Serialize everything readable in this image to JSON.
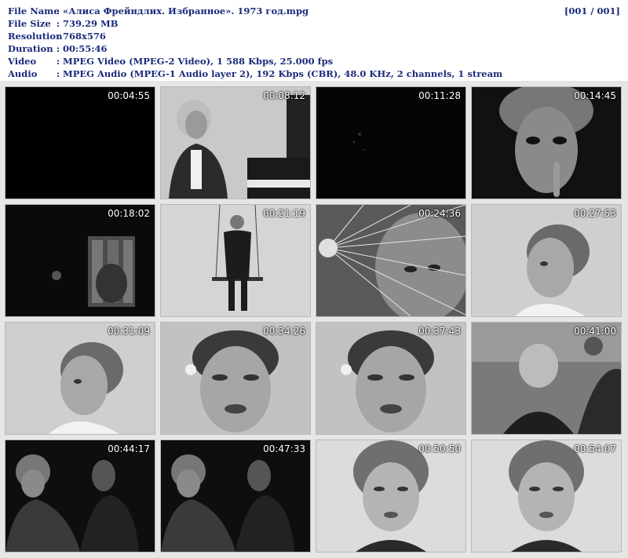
{
  "info": {
    "rows": [
      {
        "label": "File Name",
        "value": "«Алиса Фрейндлих. Избранное». 1973 год.mpg"
      },
      {
        "label": "File Size",
        "value": "739.29 MB"
      },
      {
        "label": "Resolution",
        "value": "768x576"
      },
      {
        "label": "Duration",
        "value": "00:55:46"
      },
      {
        "label": "Video",
        "value": "MPEG Video (MPEG-2 Video), 1 588 Kbps, 25.000 fps"
      },
      {
        "label": "Audio",
        "value": "MPEG Audio (MPEG-1 Audio layer 2), 192 Kbps (CBR), 48.0 KHz, 2 channels, 1 stream"
      }
    ],
    "separator": ":",
    "counter": "[001 / 001]"
  },
  "thumbnails": [
    {
      "time": "00:04:55",
      "scene": "black-frame"
    },
    {
      "time": "00:08:12",
      "scene": "woman-at-piano"
    },
    {
      "time": "00:11:28",
      "scene": "dark-frame"
    },
    {
      "time": "00:14:45",
      "scene": "closeup-face-finger"
    },
    {
      "time": "00:18:02",
      "scene": "dark-stage"
    },
    {
      "time": "00:21:19",
      "scene": "woman-on-swing"
    },
    {
      "time": "00:24:36",
      "scene": "face-behind-wheel"
    },
    {
      "time": "00:27:53",
      "scene": "short-hair-profile"
    },
    {
      "time": "00:31:09",
      "scene": "short-hair-profile"
    },
    {
      "time": "00:34:26",
      "scene": "face-with-earring"
    },
    {
      "time": "00:37:43",
      "scene": "face-with-earring"
    },
    {
      "time": "00:41:00",
      "scene": "group-scene"
    },
    {
      "time": "00:44:17",
      "scene": "two-women-dark"
    },
    {
      "time": "00:47:33",
      "scene": "two-women-dark"
    },
    {
      "time": "00:50:50",
      "scene": "curly-hair-portrait"
    },
    {
      "time": "00:54:07",
      "scene": "curly-hair-portrait"
    }
  ]
}
